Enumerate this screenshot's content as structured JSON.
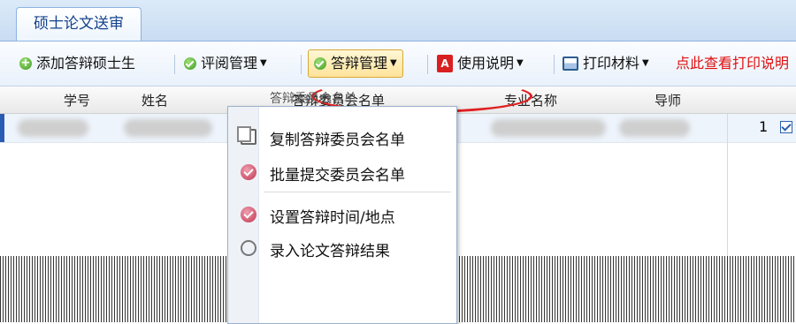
{
  "tab": {
    "label": "硕士论文送审"
  },
  "toolbar": {
    "add_label": "添加答辩硕士生",
    "review_label": "评阅管理",
    "defense_label": "答辩管理",
    "manual_label": "使用说明",
    "print_label": "打印材料",
    "link_label": "点此查看打印说明"
  },
  "grid": {
    "headers": [
      "学号",
      "姓名",
      "答辩委员会名单",
      "专业名称",
      "导师"
    ]
  },
  "row": {
    "count": "1"
  },
  "menu": {
    "header_label": "答辩委员会名单",
    "items": [
      {
        "label": "复制答辩委员会名单"
      },
      {
        "label": "批量提交委员会名单"
      },
      {
        "label": "设置答辩时间/地点"
      },
      {
        "label": "录入论文答辩结果"
      }
    ]
  },
  "colors": {
    "accent": "#15428b",
    "highlight": "#e02020",
    "menu_icon": "#c0334f"
  }
}
